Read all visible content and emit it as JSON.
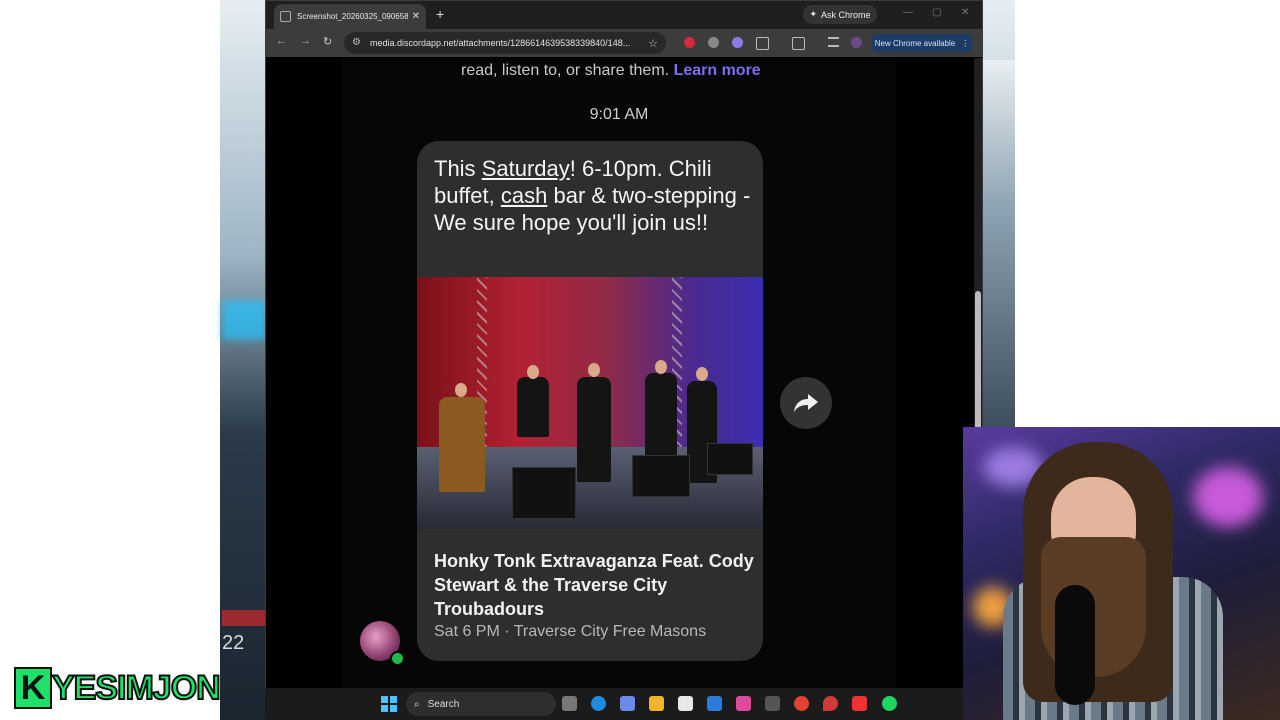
{
  "browser": {
    "tab_title": "Screenshot_20260325_090658...",
    "tab_close": "✕",
    "new_tab": "+",
    "ask_chrome": "Ask Chrome",
    "url": "media.discordapp.net/attachments/1286614639538339840/148...",
    "update_label": "New Chrome available"
  },
  "chat": {
    "info_line": "read, listen to, or share them.",
    "learn_more": "Learn more",
    "timestamp": "9:01 AM",
    "message_parts": [
      "This ",
      "Saturday",
      "!  6-10pm.  Chili buffet, ",
      "cash",
      " bar & two-stepping - We sure hope you'll join us!!"
    ],
    "event_title": "Honky Tonk Extravaganza Feat. Cody Stewart & the Traverse City Troubadours",
    "event_meta": "Sat 6 PM · Traverse City Free Masons"
  },
  "overlay": {
    "logo_k": "K",
    "logo_name": "YESIMJON",
    "background_number": "22"
  },
  "taskbar": {
    "search_label": "Search"
  },
  "colors": {
    "accent_link": "#7b6cf0",
    "online": "#20b84f",
    "logo_green": "#1ee06a",
    "chrome_update": "#1e3b66"
  }
}
